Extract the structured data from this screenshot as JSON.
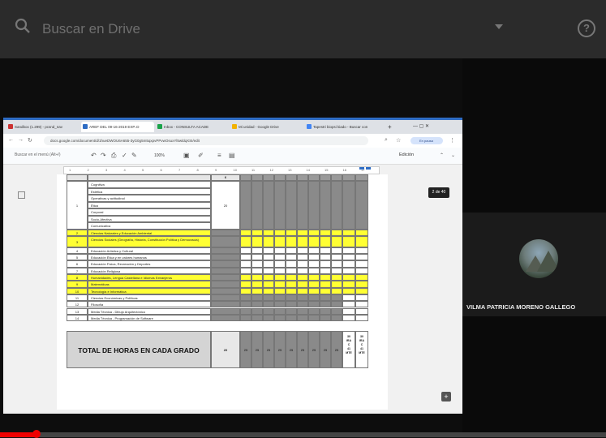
{
  "drive": {
    "search_placeholder": "Buscar en Drive",
    "help_label": "?"
  },
  "browser": {
    "tabs": [
      {
        "label": "Sandbox (1.299) - pcsnd_nav",
        "color": "#c33"
      },
      {
        "label": "AREF DEL 09-16-2019 EXP..D",
        "color": "#2e6cc4"
      },
      {
        "label": "Inbox - CONSULTA ACADE",
        "color": "#1aa34a"
      },
      {
        "label": "Mi unidad - Google Drive",
        "color": "#f2b200"
      },
      {
        "label": "Tapestri biopsi kiado - Buscar con",
        "color": "#4285f4"
      }
    ],
    "add_tab": "+",
    "url": "docs.google.com/document/d/1hueDWOU6A655-3yG0g5m5qxpvPPvwOsuxYl5wldqXSI/edit",
    "profile_label": "En pausa",
    "win_controls": "—   ▢   ✕"
  },
  "docs": {
    "menu_search": "Buscar en el menú (Alt+/)",
    "zoom": "100%",
    "edit_mode": "Edición",
    "page_indicator": "2 de 40",
    "ruler_marks": [
      "1",
      "2",
      "3",
      "4",
      "5",
      "6",
      "7",
      "8",
      "9",
      "10",
      "11",
      "12",
      "13",
      "14",
      "15",
      "16",
      "17"
    ]
  },
  "table": {
    "grade_header": "6",
    "top_group_number": "1",
    "top_group_subjects": [
      "Cognitiva",
      "Estética",
      "Operativas y actitudinal",
      "Ética",
      "Corporal",
      "Socio-Afectiva",
      "Comunicativa"
    ],
    "top_group_hours": "20",
    "rows": [
      {
        "num": "2",
        "name": "Ciencias Naturales y Educación Ambiental",
        "yellow": true
      },
      {
        "num": "3",
        "name": "Ciencias Sociales (Geografía, Historia, Constitución Política y Democracia)",
        "yellow": true
      },
      {
        "num": "4",
        "name": "Educación Artística y Cultural",
        "yellow": false
      },
      {
        "num": "5",
        "name": "Educación Ética y en valores humanos",
        "yellow": false
      },
      {
        "num": "6",
        "name": "Educación Física, Recreación y Deportes",
        "yellow": false
      },
      {
        "num": "7",
        "name": "Educación Religiosa",
        "yellow": false
      },
      {
        "num": "8",
        "name": "Humanidades, Lengua Castellana e Idiomas Extranjeros",
        "yellow": true
      },
      {
        "num": "9",
        "name": "Matemáticas",
        "yellow": true
      },
      {
        "num": "10",
        "name": "Tecnología e Informática",
        "yellow": true
      },
      {
        "num": "11",
        "name": "Ciencias Económicas y Políticas",
        "yellow": false
      },
      {
        "num": "12",
        "name": "Filosofía",
        "yellow": false
      },
      {
        "num": "13",
        "name": "Media Técnica - Dibujo Arquitectónico",
        "yellow": false
      },
      {
        "num": "14",
        "name": "Media Técnica - Programación de Software",
        "yellow": false
      }
    ],
    "total_label": "TOTAL DE HORAS EN CADA GRADO",
    "total_first": "20",
    "total_values": [
      "25",
      "25",
      "25",
      "25",
      "25",
      "25",
      "25",
      "25",
      "25"
    ],
    "last_cols": [
      [
        "30",
        "IRA",
        "C",
        "41",
        "MTE"
      ],
      [
        "30",
        "IRA",
        "C",
        "41",
        "MTE"
      ]
    ]
  },
  "participant": {
    "name": "VILMA PATRICIA MORENO GALLEGO"
  },
  "playback": {
    "progress_percent": 6
  }
}
